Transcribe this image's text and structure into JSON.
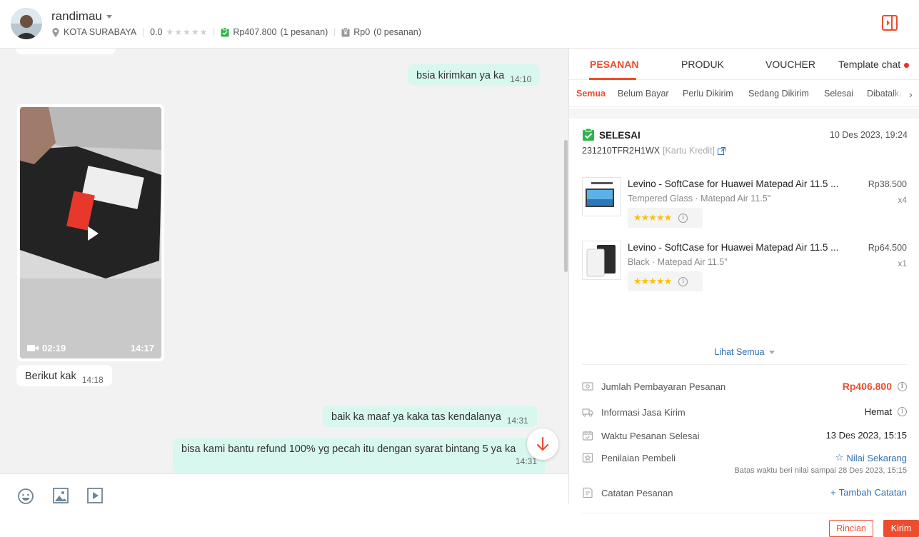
{
  "header": {
    "username": "randimau",
    "location": "KOTA SURABAYA",
    "rating": "0.0",
    "rating_stars": 0,
    "paid_amount": "Rp407.800",
    "paid_orders": "(1 pesanan)",
    "cancel_amount": "Rp0",
    "cancel_orders": "(0 pesanan)"
  },
  "chat": {
    "messages": [
      {
        "text": "bsia kirimkan ya ka",
        "time": "14:10"
      },
      {
        "text": "Berikut kak",
        "time": "14:18"
      },
      {
        "text": "baik ka maaf ya kaka tas kendalanya",
        "time": "14:31"
      },
      {
        "text": "bisa kami bantu refund 100% yg pecah itu dengan syarat bintang 5 ya ka",
        "time": "14:31"
      }
    ],
    "video": {
      "duration": "02:19",
      "time": "14:17"
    }
  },
  "panel": {
    "tabs": [
      "PESANAN",
      "PRODUK",
      "VOUCHER",
      "Template chat"
    ],
    "filters": [
      "Semua",
      "Belum Bayar",
      "Perlu Dikirim",
      "Sedang Dikirim",
      "Selesai",
      "Dibatalkan"
    ],
    "order": {
      "status": "SELESAI",
      "date": "10 Des 2023, 19:24",
      "order_no": "231210TFR2H1WX",
      "payment_method": "[Kartu Kredit]",
      "products": [
        {
          "name": "Levino - SoftCase for Huawei Matepad Air 11.5 ...",
          "variant": "Tempered Glass · Matepad Air 11.5\"",
          "price": "Rp38.500",
          "qty": "x4",
          "stars": 5
        },
        {
          "name": "Levino - SoftCase for Huawei Matepad Air 11.5 ...",
          "variant": "Black · Matepad Air 11.5\"",
          "price": "Rp64.500",
          "qty": "x1",
          "stars": 5
        }
      ],
      "see_all": "Lihat Semua",
      "rows": {
        "payment_label": "Jumlah Pembayaran Pesanan",
        "payment_value": "Rp406.800",
        "shipping_label": "Informasi Jasa Kirim",
        "shipping_value": "Hemat",
        "completed_label": "Waktu Pesanan Selesai",
        "completed_value": "13 Des 2023, 15:15",
        "review_label": "Penilaian Pembeli",
        "review_value": "Nilai Sekarang",
        "review_deadline": "Batas waktu beri nilai sampai 28 Des 2023, 15:15",
        "notes_label": "Catatan Pesanan",
        "notes_value": "Tambah Catatan"
      },
      "buttons": {
        "detail": "Rincian",
        "send": "Kirim"
      }
    }
  },
  "colors": {
    "accent": "#ee4d2d",
    "outgoing_bubble": "#d8f7ee",
    "link": "#2f6fb3",
    "success": "#2db54a"
  }
}
